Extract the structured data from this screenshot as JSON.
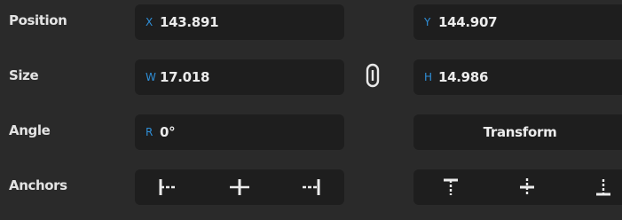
{
  "rows": {
    "position": {
      "label": "Position",
      "x": {
        "axis": "X",
        "value": "143.891"
      },
      "y": {
        "axis": "Y",
        "value": "144.907"
      }
    },
    "size": {
      "label": "Size",
      "w": {
        "axis": "W",
        "value": "17.018"
      },
      "h": {
        "axis": "H",
        "value": "14.986"
      },
      "link_icon": "aspect-lock-icon"
    },
    "angle": {
      "label": "Angle",
      "r": {
        "axis": "R",
        "value": "0°"
      },
      "transform_label": "Transform"
    },
    "anchors": {
      "label": "Anchors",
      "horizontal_icons": [
        "anchor-left-icon",
        "anchor-center-h-icon",
        "anchor-right-icon"
      ],
      "vertical_icons": [
        "anchor-top-icon",
        "anchor-center-v-icon",
        "anchor-bottom-icon"
      ]
    }
  },
  "colors": {
    "panel_bg": "#2a2a2a",
    "field_bg": "#1e1e1e",
    "axis_accent": "#2f8fd8",
    "text": "#ececec"
  }
}
